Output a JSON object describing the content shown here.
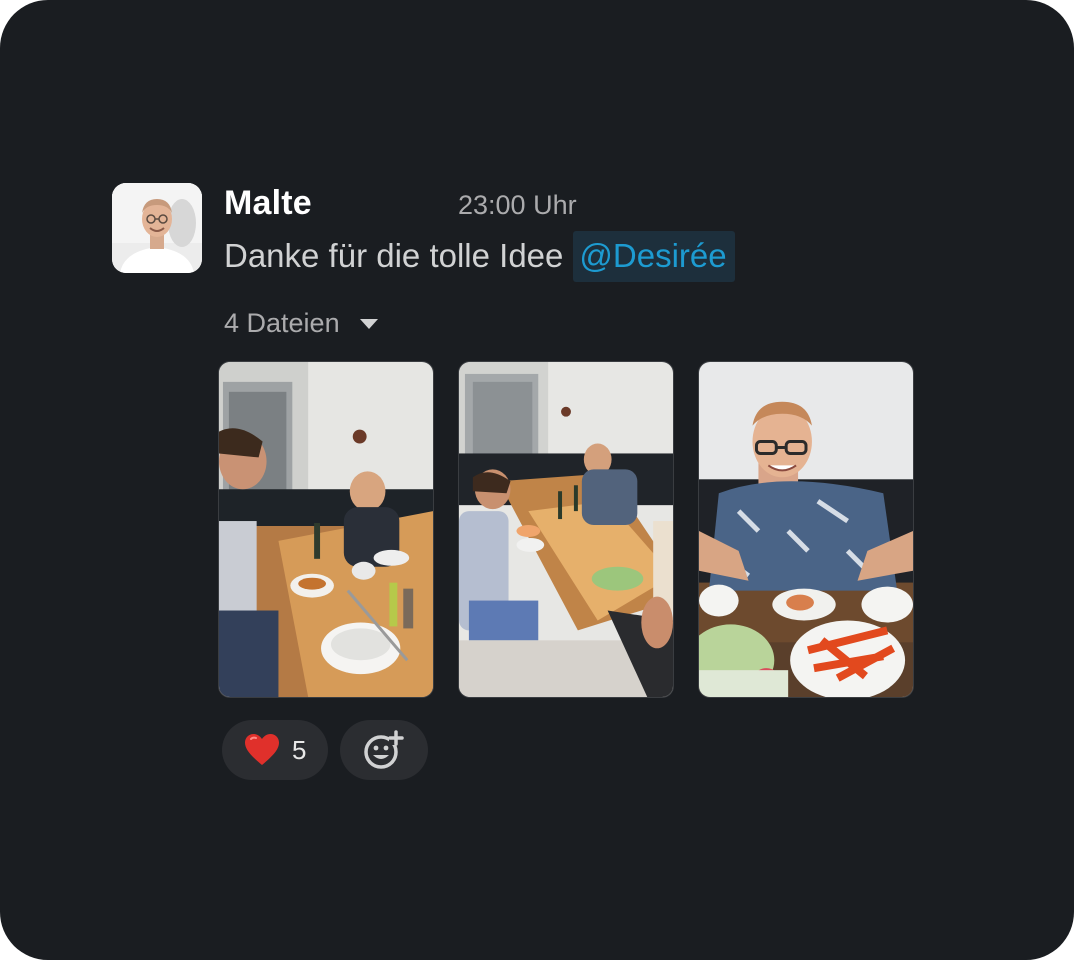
{
  "message": {
    "author": "Malte",
    "timestamp": "23:00 Uhr",
    "text": "Danke für die tolle Idee",
    "mention": "@Desirée",
    "files_label": "4 Dateien",
    "photos": [
      {
        "icon": "photo-dining-table-1"
      },
      {
        "icon": "photo-dining-table-2"
      },
      {
        "icon": "photo-dining-table-3"
      }
    ],
    "reactions": [
      {
        "emoji": "heart-icon",
        "count": "5"
      },
      {
        "emoji": "add-reaction-icon"
      }
    ]
  },
  "colors": {
    "background": "#1a1d21",
    "mention_text": "#1d9bd1",
    "mention_bg": "#1d2f3c",
    "heart": "#e0302b"
  }
}
